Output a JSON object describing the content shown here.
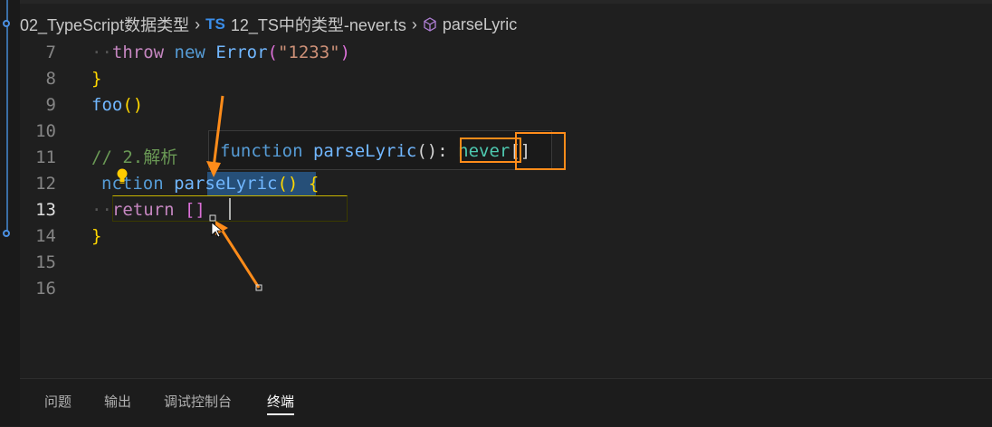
{
  "breadcrumb": {
    "folder": "02_TypeScript数据类型",
    "ts_badge": "TS",
    "file": "12_TS中的类型-never.ts",
    "symbol": "parseLyric"
  },
  "code": {
    "lines": [
      {
        "num": "7"
      },
      {
        "num": "8"
      },
      {
        "num": "9"
      },
      {
        "num": "10"
      },
      {
        "num": "11"
      },
      {
        "num": "12"
      },
      {
        "num": "13"
      },
      {
        "num": "14"
      },
      {
        "num": "15"
      },
      {
        "num": "16"
      }
    ],
    "l7_throw": "throw",
    "l7_new": "new",
    "l7_error": "Error",
    "l7_str": "\"1233\"",
    "l8_brace": "}",
    "l9_call": "foo",
    "l9_parens": "()",
    "l11_comment": "// 2.解析",
    "l12_kw": "nction",
    "l12_fn": "parseLyric",
    "l12_parens": "()",
    "l12_brace": "{",
    "l13_return": "return",
    "l13_arr": "[]",
    "l14_brace": "}"
  },
  "hover": {
    "keyword": "function",
    "name": "parseLyric",
    "sig": "():",
    "type": "never",
    "suffix": "[]"
  },
  "panel": {
    "tabs": [
      "问题",
      "输出",
      "调试控制台",
      "终端"
    ],
    "active": "终端"
  },
  "colors": {
    "accent_orange": "#ff8c1a",
    "background": "#1f1f1f"
  }
}
